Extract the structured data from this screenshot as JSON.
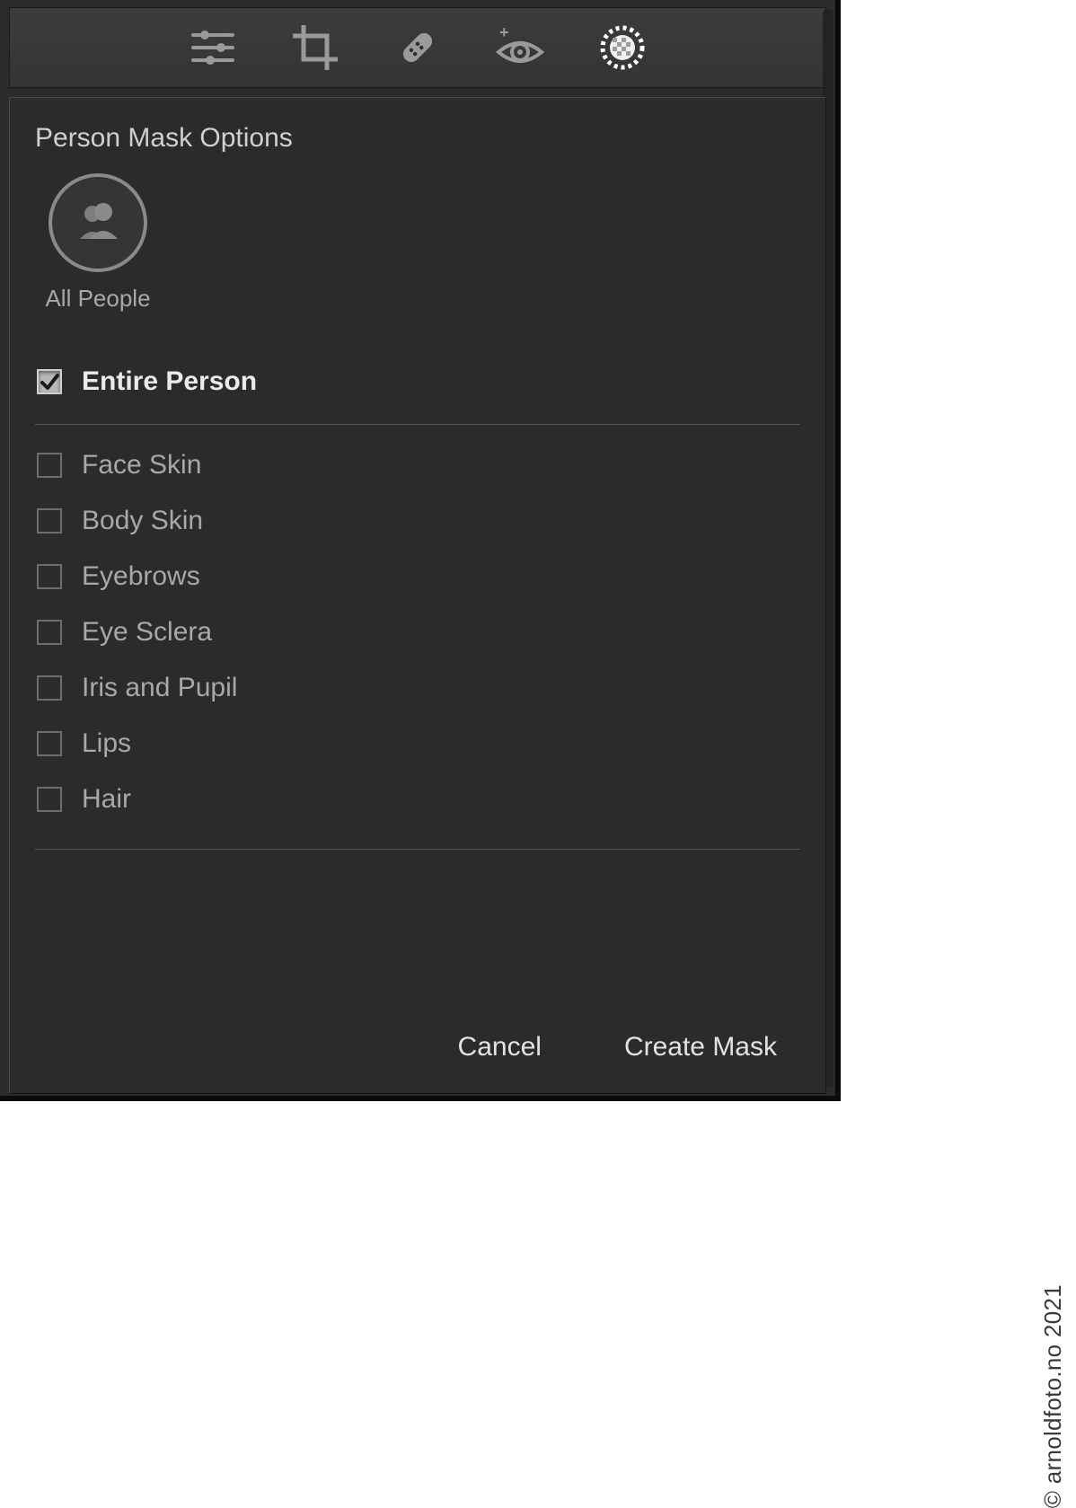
{
  "watermark": "© arnoldfoto.no 2021",
  "toolbar": {
    "items": [
      {
        "name": "edit-icon"
      },
      {
        "name": "crop-icon"
      },
      {
        "name": "healing-icon"
      },
      {
        "name": "red-eye-icon"
      },
      {
        "name": "masking-icon"
      }
    ]
  },
  "panel": {
    "title": "Person Mask Options",
    "people": [
      {
        "label": "All People"
      }
    ],
    "entirePerson": {
      "label": "Entire Person",
      "checked": true
    },
    "parts": [
      {
        "label": "Face Skin",
        "checked": false
      },
      {
        "label": "Body Skin",
        "checked": false
      },
      {
        "label": "Eyebrows",
        "checked": false
      },
      {
        "label": "Eye Sclera",
        "checked": false
      },
      {
        "label": "Iris and Pupil",
        "checked": false
      },
      {
        "label": "Lips",
        "checked": false
      },
      {
        "label": "Hair",
        "checked": false
      }
    ],
    "buttons": {
      "cancel": "Cancel",
      "create": "Create Mask"
    }
  }
}
